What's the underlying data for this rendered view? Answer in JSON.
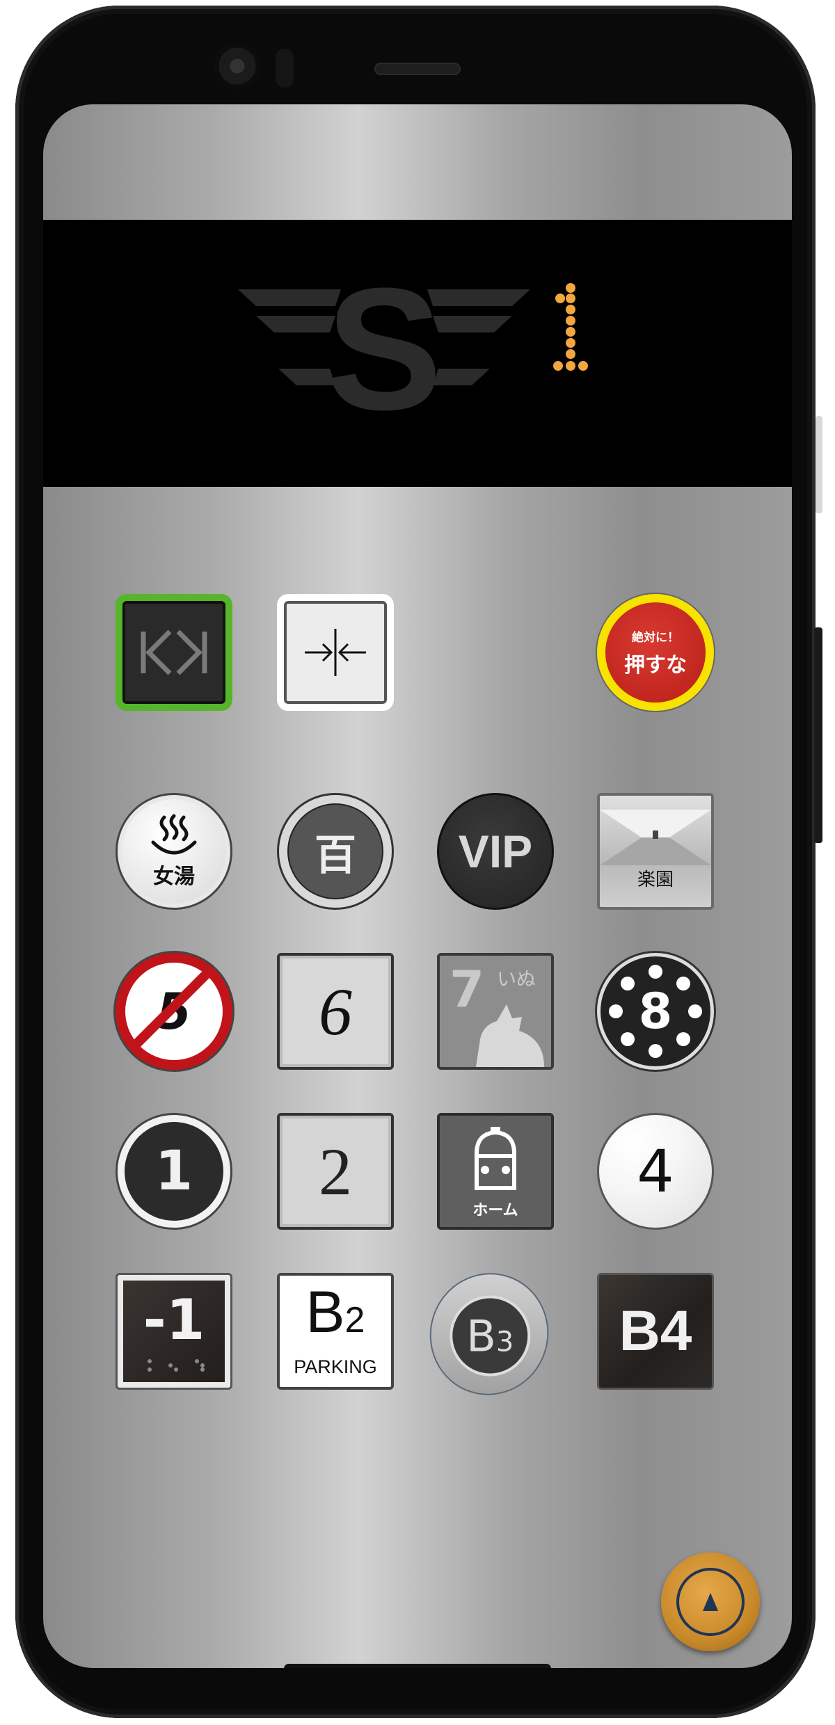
{
  "display": {
    "logo_letter": "S",
    "floor": "1",
    "floor_color": "#f2a640"
  },
  "buttons": {
    "close_label": "><",
    "danger_top": "絶対に！",
    "danger_main": "押すな",
    "onsen_label": "女湯",
    "hyaku_label": "百",
    "vip_label": "VIP",
    "rakuen_label": "楽園",
    "no5_label": "5",
    "six_label": "6",
    "seven_num": "7",
    "seven_word": "いぬ",
    "eight_label": "8",
    "one_label": "1",
    "two_label": "2",
    "home_label": "ホーム",
    "four_label": "4",
    "minus1_label": "-1",
    "b2_main": "B",
    "b2_sub": "2",
    "b2_word": "PARKING",
    "b3_main": "B",
    "b3_sub": "3",
    "b4_label": "B4"
  },
  "colors": {
    "open_border": "#56b52a",
    "danger_border": "#f7e200",
    "danger_fill": "#cc2a22",
    "fab_ring": "#1e3556"
  },
  "icons": {
    "open": "open-doors-icon",
    "close": "close-doors-icon",
    "onsen": "hot-spring-icon",
    "dog": "dog-icon",
    "train": "train-icon",
    "fab": "up-arrow-icon"
  }
}
